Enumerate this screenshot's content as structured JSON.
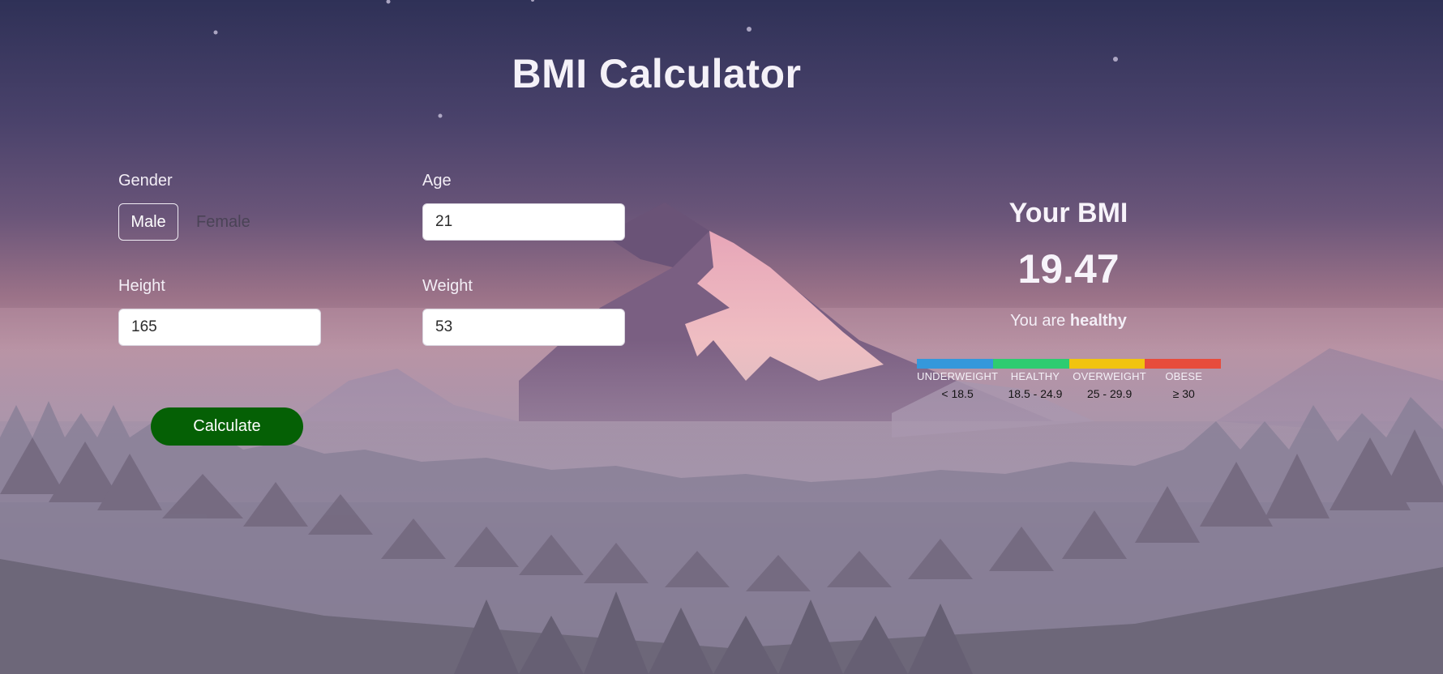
{
  "page": {
    "title": "BMI Calculator"
  },
  "form": {
    "gender_label": "Gender",
    "gender_options": {
      "male": "Male",
      "female": "Female"
    },
    "gender_selected": "Male",
    "age_label": "Age",
    "age_value": "21",
    "height_label": "Height",
    "height_value": "165",
    "weight_label": "Weight",
    "weight_value": "53",
    "calculate_label": "Calculate"
  },
  "result": {
    "heading": "Your BMI",
    "value": "19.47",
    "status_prefix": "You are",
    "status": "healthy"
  },
  "scale": [
    {
      "name": "UNDERWEIGHT",
      "range": "< 18.5",
      "color": "#3498db"
    },
    {
      "name": "HEALTHY",
      "range": "18.5 - 24.9",
      "color": "#2ecc71"
    },
    {
      "name": "OVERWEIGHT",
      "range": "25 - 29.9",
      "color": "#f1c40f"
    },
    {
      "name": "OBESE",
      "range": "≥ 30",
      "color": "#e74c3c"
    }
  ],
  "colors": {
    "calculate_button": "#056005",
    "text": "#ffffff"
  }
}
